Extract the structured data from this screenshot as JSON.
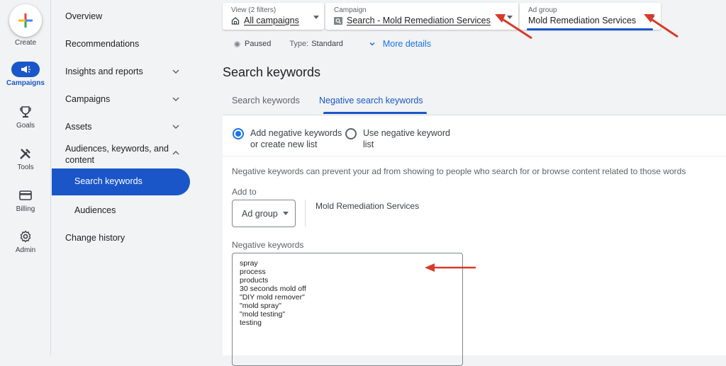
{
  "rail": {
    "create": "Create",
    "items": [
      {
        "label": "Campaigns",
        "icon": "megaphone-icon",
        "active": true
      },
      {
        "label": "Goals",
        "icon": "trophy-icon"
      },
      {
        "label": "Tools",
        "icon": "tools-icon"
      },
      {
        "label": "Billing",
        "icon": "credit-card-icon"
      },
      {
        "label": "Admin",
        "icon": "gear-icon"
      }
    ]
  },
  "nav": {
    "items": [
      {
        "label": "Overview"
      },
      {
        "label": "Recommendations"
      },
      {
        "label": "Insights and reports",
        "chevron": "down"
      },
      {
        "label": "Campaigns",
        "chevron": "down"
      },
      {
        "label": "Assets",
        "chevron": "down"
      },
      {
        "label": "Audiences, keywords, and content",
        "chevron": "up"
      }
    ],
    "sub_items": [
      {
        "label": "Search keywords",
        "active": true
      },
      {
        "label": "Audiences"
      }
    ],
    "change_history": "Change history"
  },
  "filters": {
    "view": {
      "caption": "View (2 filters)",
      "value": "All campaigns"
    },
    "campaign": {
      "caption": "Campaign",
      "value": "Search - Mold Remediation Services"
    },
    "ad_group": {
      "caption": "Ad group",
      "value": "Mold Remediation Services"
    }
  },
  "status": {
    "state": "Paused",
    "type_label": "Type:",
    "type_value": "Standard",
    "more_details": "More details"
  },
  "page": {
    "title": "Search keywords",
    "tabs": [
      {
        "label": "Search keywords"
      },
      {
        "label": "Negative search keywords",
        "active": true
      }
    ]
  },
  "form": {
    "radio_add": "Add negative keywords or create new list",
    "radio_use": "Use negative keyword list",
    "info": "Negative keywords can prevent your ad from showing to people who search for or browse content related to those words",
    "add_to_label": "Add to",
    "add_to_select": "Ad group",
    "add_to_value": "Mold Remediation Services",
    "negative_keywords_label": "Negative keywords",
    "keywords": [
      "spray",
      "process",
      "products",
      "30 seconds mold off",
      "\"DIY mold remover\"",
      "\"mold spray\"",
      "\"mold testing\"",
      "testing"
    ]
  },
  "colors": {
    "accent": "#1a56c8",
    "annotation_arrow": "#d93a2b"
  }
}
